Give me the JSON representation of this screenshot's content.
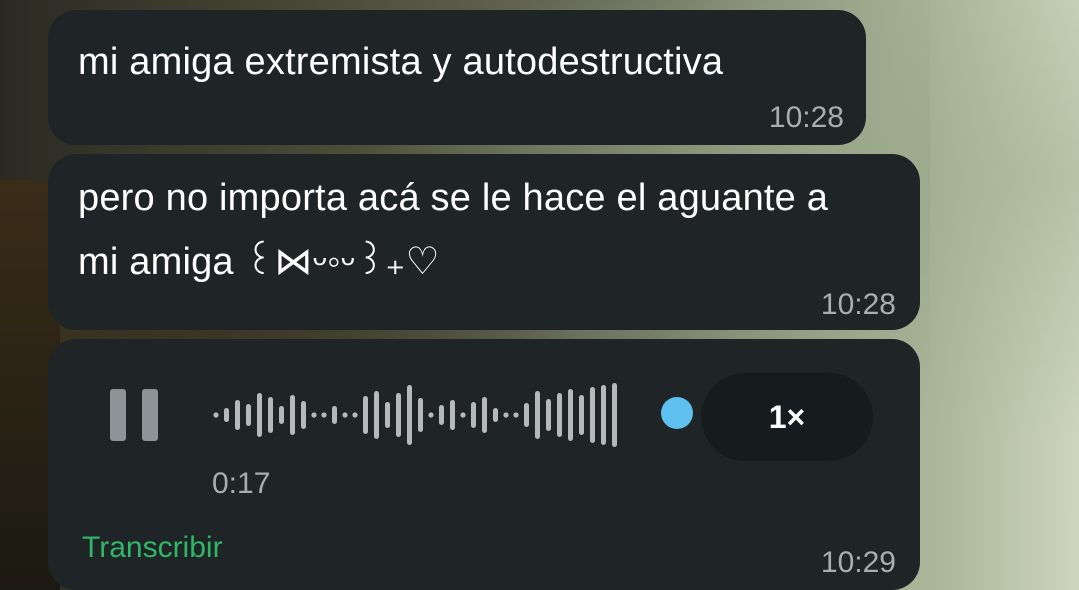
{
  "messages": [
    {
      "text": "mi amiga extremista y autodestructiva",
      "time": "10:28"
    },
    {
      "text": "pero no importa acá se le hace el aguante a mi amiga ꒰⋈ᵕ◦ᵕ꒱₊♡",
      "time": "10:28"
    }
  ],
  "voice_message": {
    "state": "playing",
    "progress": 1.0,
    "duration": "0:17",
    "speed_label": "1×",
    "transcribe_label": "Transcribir",
    "time": "10:29",
    "accent_color": "#5ec0ee"
  },
  "colors": {
    "bubble": "#1f2427",
    "transcribe": "#31b567",
    "timestamp": "#a8adb1"
  },
  "icons": [
    "pause-icon"
  ]
}
